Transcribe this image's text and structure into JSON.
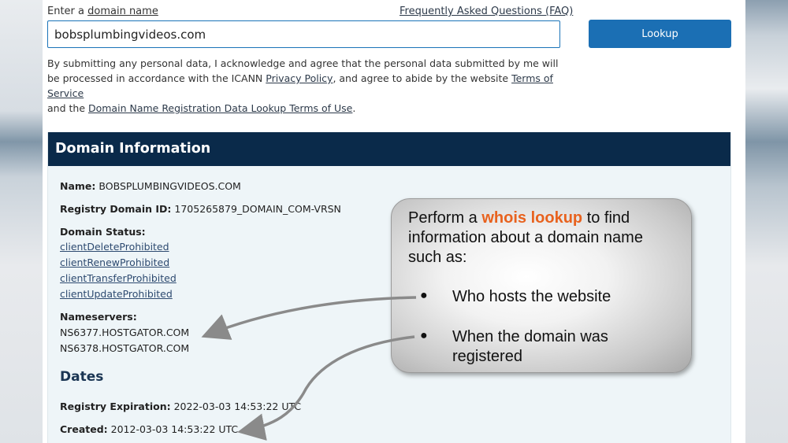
{
  "lookup": {
    "label_prefix": "Enter a ",
    "label_link": "domain name",
    "faq_link": "Frequently Asked Questions (FAQ)",
    "input_value": "bobsplumbingvideos.com",
    "button_label": "Lookup"
  },
  "consent": {
    "text1": "By submitting any personal data, I acknowledge and agree that the personal data submitted by me will be processed in accordance with the ICANN ",
    "privacy_link": "Privacy Policy",
    "text2": ", and agree to abide by the website ",
    "tos_link": "Terms of Service",
    "text3": " and the ",
    "rdap_link": "Domain Name Registration Data Lookup Terms of Use",
    "text4": "."
  },
  "domain_info": {
    "header": "Domain Information",
    "name_label": "Name:",
    "name_value": "BOBSPLUMBINGVIDEOS.COM",
    "registry_id_label": "Registry Domain ID:",
    "registry_id_value": "1705265879_DOMAIN_COM-VRSN",
    "status_label": "Domain Status:",
    "statuses": [
      "clientDeleteProhibited",
      "clientRenewProhibited",
      "clientTransferProhibited",
      "clientUpdateProhibited"
    ],
    "nameservers_label": "Nameservers:",
    "nameservers": [
      "NS6377.HOSTGATOR.COM",
      "NS6378.HOSTGATOR.COM"
    ]
  },
  "dates": {
    "title": "Dates",
    "expiration_label": "Registry Expiration:",
    "expiration_value": "2022-03-03 14:53:22 UTC",
    "created_label": "Created:",
    "created_value": "2012-03-03 14:53:22 UTC"
  },
  "callout": {
    "intro_before": "Perform a ",
    "intro_highlight": "whois lookup",
    "intro_after": " to find information about a domain name such as:",
    "bullets": [
      "Who hosts the website",
      "When the domain was registered"
    ],
    "highlight_color": "#e8621e"
  }
}
